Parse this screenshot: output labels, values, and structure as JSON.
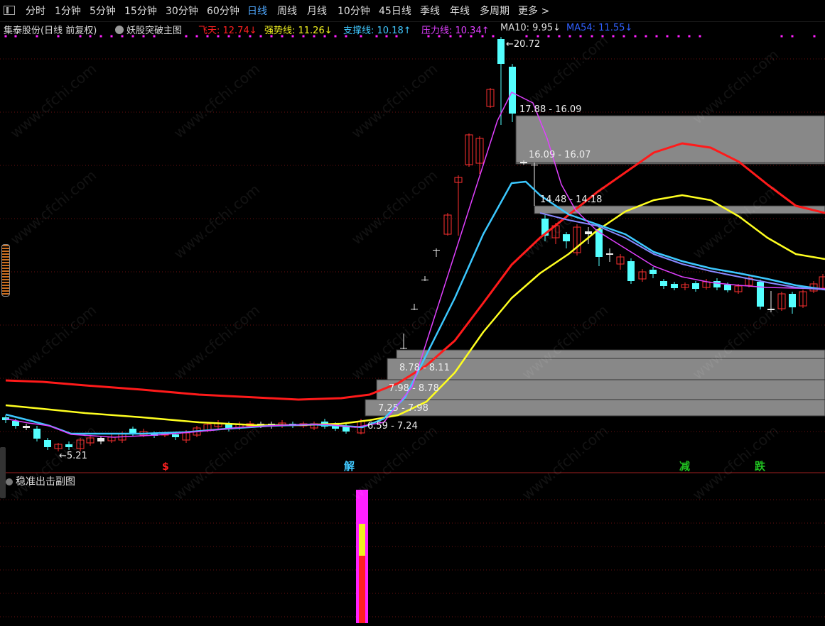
{
  "toolbar": {
    "periods": [
      "分时",
      "1分钟",
      "5分钟",
      "15分钟",
      "30分钟",
      "60分钟",
      "日线",
      "周线",
      "月线",
      "10分钟",
      "45日线",
      "季线",
      "年线",
      "多周期",
      "更多 >"
    ],
    "active": "日线"
  },
  "info": {
    "stock": "集泰股份(日线 前复权)",
    "indicator": "妖股突破主图",
    "lines": [
      {
        "text": "飞天: 12.74↓",
        "color": "#ff2020"
      },
      {
        "text": "强势线: 11.26↓",
        "color": "#f0f020"
      },
      {
        "text": "支撑线: 10.18↑",
        "color": "#40c8ff"
      },
      {
        "text": "压力线: 10.34↑",
        "color": "#e040ff"
      },
      {
        "text": "MA10: 9.95↓",
        "color": "#dddddd"
      },
      {
        "text": "MA54: 11.55↓",
        "color": "#3060ff"
      }
    ]
  },
  "zones": [
    {
      "label": "17.88 - 16.09"
    },
    {
      "label": "16.09 - 16.07"
    },
    {
      "label": "14.48 - 14.18"
    },
    {
      "label": "8.78 - 8.11"
    },
    {
      "label": "7.98 - 8.78"
    },
    {
      "label": "7.25 - 7.98"
    },
    {
      "label": "6.59 - 7.24"
    }
  ],
  "price_marks": {
    "high": "20.72",
    "low": "←5.21"
  },
  "signals": [
    {
      "text": "$",
      "color": "#ff2020"
    },
    {
      "text": "解",
      "color": "#40c8ff"
    },
    {
      "text": "减",
      "color": "#20c020"
    },
    {
      "text": "跌",
      "color": "#20c020"
    }
  ],
  "subchart": {
    "title": "稳准出击副图"
  },
  "watermark": "www.cfchi.com"
}
